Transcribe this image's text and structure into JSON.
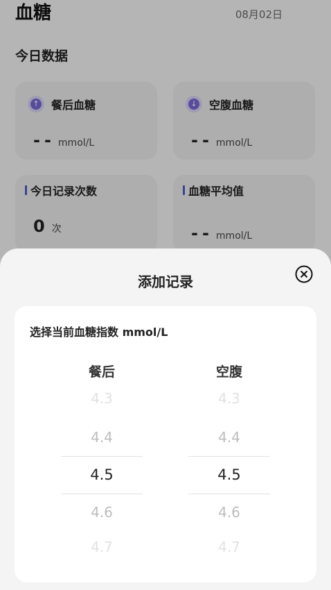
{
  "header": {
    "title": "血糖",
    "date": "08月02日"
  },
  "today": {
    "section_title": "今日数据",
    "cards": [
      {
        "label": "餐后血糖",
        "value": "--",
        "unit": "mmol/L",
        "icon": "arrow-up-circle-icon"
      },
      {
        "label": "空腹血糖",
        "value": "--",
        "unit": "mmol/L",
        "icon": "arrow-down-circle-icon"
      },
      {
        "label": "今日记录次数",
        "value": "0",
        "unit": "次"
      },
      {
        "label": "血糖平均值",
        "value": "--",
        "unit": "mmol/L"
      }
    ]
  },
  "sheet": {
    "title": "添加记录",
    "prompt": "选择当前血糖指数 mmol/L",
    "columns": [
      {
        "title": "餐后",
        "options": [
          "4.3",
          "4.4",
          "4.5",
          "4.6",
          "4.7"
        ],
        "selected": "4.5"
      },
      {
        "title": "空腹",
        "options": [
          "4.3",
          "4.4",
          "4.5",
          "4.6",
          "4.7"
        ],
        "selected": "4.5"
      }
    ]
  },
  "colors": {
    "accent": "#7566cf",
    "bar": "#4a5cc0",
    "sheet_bg": "#f4f4f4"
  }
}
